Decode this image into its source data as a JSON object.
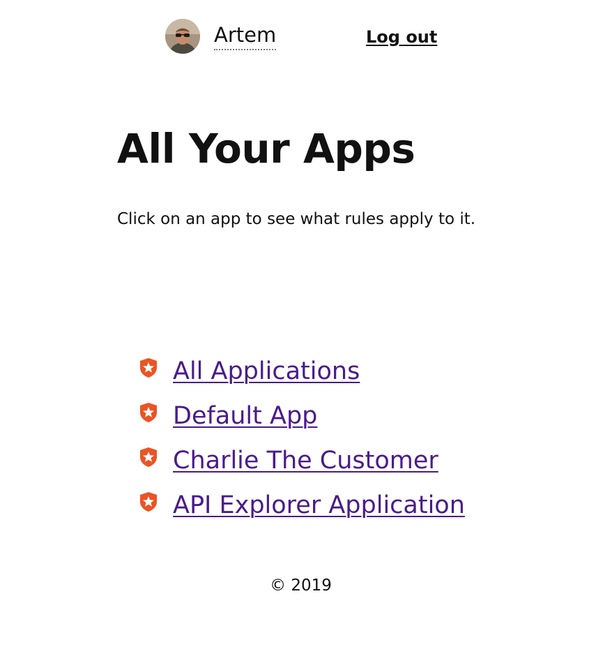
{
  "header": {
    "user_name": "Artem",
    "logout_label": "Log out"
  },
  "main": {
    "title": "All Your Apps",
    "intro": "Click on an app to see what rules apply to it.",
    "apps": [
      {
        "name": "All Applications",
        "icon": "auth0-shield-icon"
      },
      {
        "name": "Default App",
        "icon": "auth0-shield-icon"
      },
      {
        "name": "Charlie The Customer",
        "icon": "auth0-shield-icon"
      },
      {
        "name": "API Explorer Application",
        "icon": "auth0-shield-icon"
      }
    ]
  },
  "footer": {
    "copyright": "© 2019"
  },
  "colors": {
    "link": "#4a1b8c",
    "icon": "#eb5424",
    "text": "#111111"
  }
}
